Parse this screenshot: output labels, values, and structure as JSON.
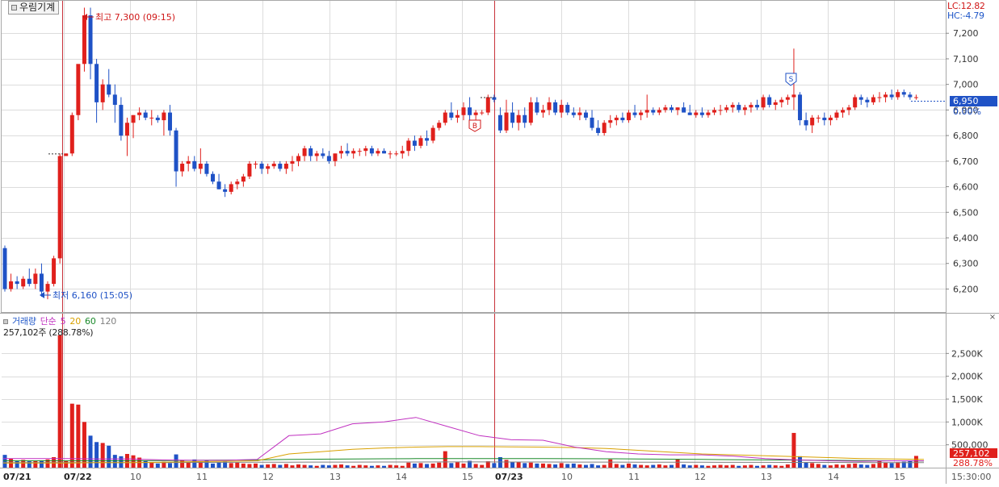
{
  "window": {
    "stock_name": "우림기계"
  },
  "indicators": {
    "lc": "LC:12.82",
    "hc": "HC:-4.79"
  },
  "price_panel": {
    "high_annotation": "최고 7,300 (09:15)",
    "low_annotation": "최저 6,160 (15:05)",
    "current_price": "6,950",
    "current_change": "0.00%",
    "buy_marker": "B",
    "sell_marker": "S"
  },
  "volume_panel": {
    "legend": {
      "title": "거래량",
      "ma_type": "단순",
      "ma5": "5",
      "ma20": "20",
      "ma60": "60",
      "ma120": "120"
    },
    "readout": "257,102주 (288.78%)",
    "current_volume": "257,102",
    "current_pct": "288.78%",
    "close_glyph": "×"
  },
  "colors": {
    "up": "#e0201c",
    "down": "#1f52c6",
    "grid": "#dcdcdc",
    "divider": "#c8323a",
    "ma5": "#c030c0",
    "ma20": "#d8a000",
    "ma60": "#1a8a2a",
    "ma120": "#808080"
  },
  "chart_data": [
    {
      "type": "candlestick",
      "title": "",
      "x_ticks": [
        "07/21",
        "07/22",
        "10",
        "11",
        "12",
        "13",
        "14",
        "15",
        "07/23",
        "10",
        "11",
        "12",
        "13",
        "14",
        "15",
        "15:30:00"
      ],
      "y_ticks": [
        "6,200",
        "6,300",
        "6,400",
        "6,500",
        "6,600",
        "6,700",
        "6,800",
        "6,900",
        "7,000",
        "7,100",
        "7,200"
      ],
      "ylim": [
        6110,
        7330
      ],
      "high": 7300,
      "low": 6160,
      "last": 6950,
      "candles": [
        [
          6360,
          6370,
          6190,
          6200
        ],
        [
          6200,
          6260,
          6190,
          6230
        ],
        [
          6230,
          6250,
          6200,
          6220
        ],
        [
          6210,
          6250,
          6200,
          6240
        ],
        [
          6240,
          6280,
          6210,
          6220
        ],
        [
          6220,
          6280,
          6200,
          6260
        ],
        [
          6260,
          6300,
          6170,
          6190
        ],
        [
          6190,
          6230,
          6160,
          6220
        ],
        [
          6220,
          6330,
          6210,
          6320
        ],
        [
          6320,
          6730,
          6300,
          6720
        ],
        [
          6720,
          6730,
          6720,
          6730
        ],
        [
          6730,
          6890,
          6720,
          6880
        ],
        [
          6880,
          7000,
          6860,
          7080
        ],
        [
          7080,
          7300,
          7050,
          7270
        ],
        [
          7270,
          7300,
          7020,
          7080
        ],
        [
          7080,
          7100,
          6850,
          6930
        ],
        [
          6930,
          7020,
          6900,
          7000
        ],
        [
          7000,
          7060,
          6950,
          6960
        ],
        [
          6960,
          7000,
          6850,
          6920
        ],
        [
          6920,
          6950,
          6780,
          6800
        ],
        [
          6800,
          6870,
          6720,
          6850
        ],
        [
          6850,
          6880,
          6790,
          6880
        ],
        [
          6880,
          6910,
          6860,
          6890
        ],
        [
          6890,
          6900,
          6860,
          6870
        ],
        [
          6870,
          6900,
          6840,
          6870
        ],
        [
          6870,
          6880,
          6850,
          6860
        ],
        [
          6860,
          6900,
          6800,
          6890
        ],
        [
          6890,
          6920,
          6800,
          6820
        ],
        [
          6820,
          6830,
          6600,
          6660
        ],
        [
          6660,
          6700,
          6640,
          6690
        ],
        [
          6690,
          6720,
          6660,
          6700
        ],
        [
          6700,
          6720,
          6660,
          6670
        ],
        [
          6670,
          6750,
          6650,
          6690
        ],
        [
          6690,
          6700,
          6640,
          6650
        ],
        [
          6650,
          6660,
          6610,
          6620
        ],
        [
          6620,
          6650,
          6590,
          6590
        ],
        [
          6590,
          6610,
          6560,
          6580
        ],
        [
          6580,
          6620,
          6570,
          6610
        ],
        [
          6610,
          6630,
          6590,
          6620
        ],
        [
          6620,
          6650,
          6600,
          6640
        ],
        [
          6640,
          6700,
          6630,
          6690
        ],
        [
          6690,
          6700,
          6670,
          6690
        ],
        [
          6690,
          6700,
          6650,
          6670
        ],
        [
          6670,
          6690,
          6650,
          6680
        ],
        [
          6680,
          6700,
          6670,
          6690
        ],
        [
          6690,
          6700,
          6660,
          6670
        ],
        [
          6670,
          6700,
          6650,
          6690
        ],
        [
          6690,
          6720,
          6660,
          6700
        ],
        [
          6700,
          6730,
          6680,
          6720
        ],
        [
          6720,
          6760,
          6700,
          6750
        ],
        [
          6750,
          6760,
          6700,
          6720
        ],
        [
          6720,
          6740,
          6700,
          6730
        ],
        [
          6730,
          6750,
          6710,
          6720
        ],
        [
          6720,
          6740,
          6690,
          6700
        ],
        [
          6700,
          6730,
          6680,
          6730
        ],
        [
          6730,
          6760,
          6710,
          6740
        ],
        [
          6740,
          6770,
          6720,
          6730
        ],
        [
          6730,
          6750,
          6710,
          6740
        ],
        [
          6740,
          6750,
          6720,
          6740
        ],
        [
          6740,
          6760,
          6720,
          6750
        ],
        [
          6750,
          6760,
          6720,
          6730
        ],
        [
          6730,
          6750,
          6720,
          6740
        ],
        [
          6740,
          6750,
          6730,
          6730
        ],
        [
          6730,
          6740,
          6710,
          6730
        ],
        [
          6730,
          6740,
          6720,
          6730
        ],
        [
          6730,
          6760,
          6710,
          6740
        ],
        [
          6740,
          6790,
          6720,
          6780
        ],
        [
          6780,
          6800,
          6740,
          6760
        ],
        [
          6760,
          6800,
          6750,
          6790
        ],
        [
          6790,
          6820,
          6760,
          6780
        ],
        [
          6780,
          6840,
          6770,
          6830
        ],
        [
          6830,
          6860,
          6820,
          6850
        ],
        [
          6850,
          6900,
          6840,
          6890
        ],
        [
          6890,
          6930,
          6860,
          6870
        ],
        [
          6870,
          6900,
          6850,
          6880
        ],
        [
          6880,
          6930,
          6860,
          6910
        ],
        [
          6910,
          6950,
          6860,
          6880
        ],
        [
          6880,
          6900,
          6860,
          6890
        ],
        [
          6890,
          6900,
          6880,
          6890
        ],
        [
          6890,
          6960,
          6880,
          6950
        ],
        [
          6950,
          6960,
          6930,
          6940
        ],
        [
          6880,
          6910,
          6810,
          6820
        ],
        [
          6820,
          6940,
          6810,
          6890
        ],
        [
          6890,
          6930,
          6830,
          6850
        ],
        [
          6850,
          6900,
          6820,
          6880
        ],
        [
          6880,
          6910,
          6830,
          6850
        ],
        [
          6850,
          6950,
          6840,
          6930
        ],
        [
          6930,
          6950,
          6880,
          6890
        ],
        [
          6890,
          6920,
          6870,
          6900
        ],
        [
          6900,
          6950,
          6880,
          6930
        ],
        [
          6930,
          6940,
          6880,
          6890
        ],
        [
          6890,
          6940,
          6870,
          6920
        ],
        [
          6920,
          6930,
          6880,
          6890
        ],
        [
          6890,
          6910,
          6870,
          6880
        ],
        [
          6880,
          6910,
          6860,
          6890
        ],
        [
          6890,
          6900,
          6860,
          6870
        ],
        [
          6870,
          6900,
          6820,
          6830
        ],
        [
          6830,
          6860,
          6800,
          6810
        ],
        [
          6810,
          6860,
          6800,
          6850
        ],
        [
          6850,
          6880,
          6830,
          6860
        ],
        [
          6860,
          6880,
          6840,
          6870
        ],
        [
          6870,
          6890,
          6850,
          6860
        ],
        [
          6860,
          6900,
          6850,
          6890
        ],
        [
          6890,
          6920,
          6870,
          6880
        ],
        [
          6880,
          6900,
          6860,
          6890
        ],
        [
          6890,
          6960,
          6870,
          6900
        ],
        [
          6900,
          6910,
          6880,
          6890
        ],
        [
          6890,
          6910,
          6880,
          6900
        ],
        [
          6900,
          6920,
          6890,
          6910
        ],
        [
          6910,
          6920,
          6890,
          6900
        ],
        [
          6900,
          6910,
          6880,
          6910
        ],
        [
          6910,
          6930,
          6900,
          6890
        ],
        [
          6890,
          6920,
          6880,
          6880
        ],
        [
          6880,
          6900,
          6870,
          6890
        ],
        [
          6890,
          6910,
          6870,
          6880
        ],
        [
          6880,
          6900,
          6870,
          6890
        ],
        [
          6890,
          6910,
          6880,
          6900
        ],
        [
          6900,
          6920,
          6880,
          6900
        ],
        [
          6900,
          6920,
          6890,
          6910
        ],
        [
          6910,
          6930,
          6890,
          6920
        ],
        [
          6920,
          6930,
          6890,
          6900
        ],
        [
          6900,
          6920,
          6880,
          6910
        ],
        [
          6910,
          6930,
          6890,
          6920
        ],
        [
          6920,
          6940,
          6900,
          6910
        ],
        [
          6910,
          6960,
          6900,
          6950
        ],
        [
          6950,
          6960,
          6910,
          6920
        ],
        [
          6920,
          6940,
          6900,
          6930
        ],
        [
          6930,
          6950,
          6910,
          6940
        ],
        [
          6940,
          6960,
          6920,
          6950
        ],
        [
          6950,
          7140,
          6900,
          6960
        ],
        [
          6960,
          6970,
          6840,
          6860
        ],
        [
          6860,
          6890,
          6820,
          6840
        ],
        [
          6840,
          6880,
          6810,
          6870
        ],
        [
          6870,
          6880,
          6850,
          6870
        ],
        [
          6870,
          6890,
          6840,
          6860
        ],
        [
          6860,
          6880,
          6840,
          6870
        ],
        [
          6870,
          6900,
          6860,
          6890
        ],
        [
          6890,
          6910,
          6870,
          6900
        ],
        [
          6900,
          6920,
          6880,
          6910
        ],
        [
          6910,
          6960,
          6900,
          6950
        ],
        [
          6950,
          6960,
          6920,
          6940
        ],
        [
          6940,
          6950,
          6910,
          6930
        ],
        [
          6930,
          6960,
          6920,
          6950
        ],
        [
          6950,
          6970,
          6930,
          6950
        ],
        [
          6950,
          6970,
          6930,
          6960
        ],
        [
          6960,
          6980,
          6940,
          6950
        ],
        [
          6950,
          6980,
          6940,
          6970
        ],
        [
          6970,
          6980,
          6950,
          6960
        ],
        [
          6960,
          6970,
          6940,
          6950
        ],
        [
          6950,
          6960,
          6940,
          6950
        ]
      ]
    },
    {
      "type": "bar",
      "title": "거래량",
      "y_ticks": [
        "500,000",
        "1,000,000",
        "1,500,000",
        "2,000,000",
        "2,500,000"
      ],
      "ylim": [
        0,
        3000000
      ],
      "volumes": [
        280000,
        200000,
        150000,
        170000,
        140000,
        150000,
        160000,
        180000,
        230000,
        2900000,
        150000,
        1400000,
        1380000,
        1000000,
        700000,
        560000,
        540000,
        480000,
        280000,
        250000,
        300000,
        270000,
        220000,
        150000,
        110000,
        90000,
        130000,
        100000,
        290000,
        150000,
        120000,
        180000,
        130000,
        160000,
        90000,
        110000,
        130000,
        100000,
        110000,
        90000,
        80000,
        90000,
        60000,
        70000,
        80000,
        60000,
        80000,
        50000,
        70000,
        60000,
        50000,
        40000,
        60000,
        50000,
        60000,
        70000,
        50000,
        40000,
        60000,
        50000,
        40000,
        50000,
        40000,
        60000,
        50000,
        40000,
        110000,
        90000,
        100000,
        80000,
        90000,
        110000,
        360000,
        100000,
        120000,
        90000,
        150000,
        80000,
        60000,
        140000,
        100000,
        230000,
        170000,
        130000,
        120000,
        100000,
        110000,
        90000,
        90000,
        80000,
        70000,
        100000,
        80000,
        90000,
        70000,
        60000,
        80000,
        50000,
        60000,
        180000,
        80000,
        60000,
        90000,
        70000,
        60000,
        50000,
        60000,
        70000,
        50000,
        60000,
        180000,
        70000,
        50000,
        60000,
        50000,
        40000,
        50000,
        60000,
        50000,
        60000,
        40000,
        50000,
        60000,
        40000,
        50000,
        60000,
        50000,
        40000,
        70000,
        760000,
        250000,
        120000,
        100000,
        80000,
        60000,
        50000,
        70000,
        60000,
        80000,
        90000,
        70000,
        60000,
        80000,
        150000,
        110000,
        100000,
        120000,
        130000,
        160000,
        257102
      ],
      "ma5_series": [
        200000,
        200000,
        200000,
        190000,
        190000,
        170000,
        160000,
        160000,
        180000,
        700000,
        740000,
        960000,
        1000000,
        1100000,
        900000,
        700000,
        610000,
        600000,
        450000,
        350000,
        300000,
        280000,
        280000,
        250000,
        200000,
        170000,
        150000,
        140000,
        150000,
        150000
      ],
      "ma20_series": [
        100000,
        100000,
        100000,
        110000,
        110000,
        120000,
        130000,
        140000,
        150000,
        300000,
        350000,
        400000,
        430000,
        450000,
        460000,
        460000,
        455000,
        450000,
        440000,
        420000,
        380000,
        340000,
        300000,
        280000,
        260000,
        240000,
        220000,
        200000,
        190000,
        180000
      ],
      "ma60_series": [
        150000,
        150000,
        150000,
        150000,
        150000,
        155000,
        160000,
        165000,
        170000,
        180000,
        185000,
        190000,
        195000,
        198000,
        200000,
        200000,
        200000,
        198000,
        196000,
        194000,
        190000,
        185000,
        180000,
        175000,
        170000,
        165000,
        160000,
        155000,
        150000,
        145000
      ],
      "ma120_series": [
        110000,
        110000,
        110000,
        110000,
        110000,
        112000,
        114000,
        116000,
        118000,
        120000,
        121000,
        122000,
        123000,
        124000,
        125000,
        125000,
        124000,
        123000,
        122000,
        121000,
        120000,
        119000,
        118000,
        117000,
        116000,
        115000,
        114000,
        113000,
        112000,
        111000
      ]
    }
  ]
}
